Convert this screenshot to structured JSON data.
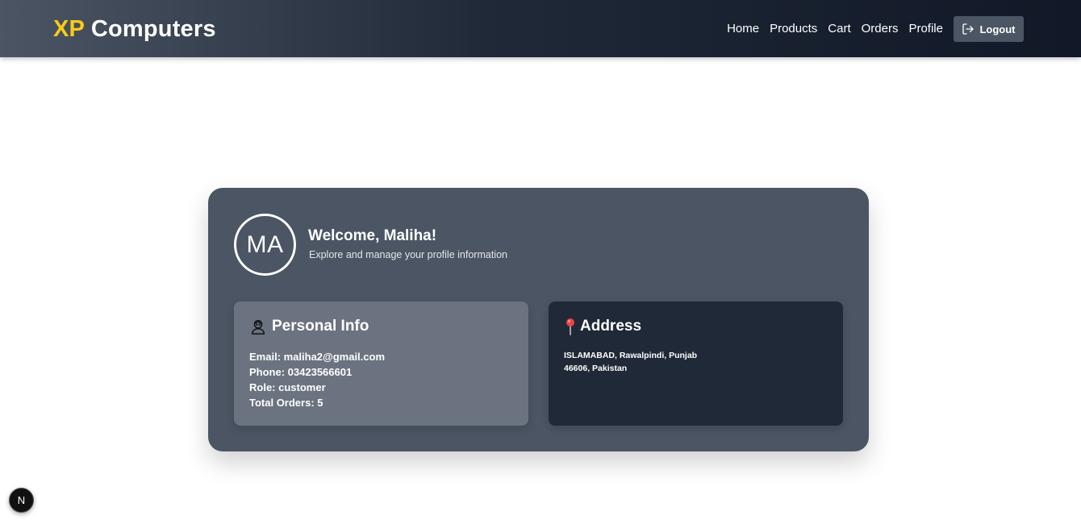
{
  "header": {
    "brand_prefix": "XP",
    "brand_rest": "Computers",
    "nav": [
      "Home",
      "Products",
      "Cart",
      "Orders",
      "Profile"
    ],
    "logout_label": "Logout"
  },
  "profile": {
    "initials": "MA",
    "welcome": "Welcome, Maliha!",
    "subtitle": "Explore and manage your profile information",
    "personal": {
      "title": "Personal Info",
      "email": "Email: maliha2@gmail.com",
      "phone": "Phone: 03423566601",
      "role": "Role: customer",
      "orders": "Total Orders: 5"
    },
    "address": {
      "title": "Address",
      "line1": "ISLAMABAD, Rawalpindi, Punjab",
      "line2": "46606, Pakistan"
    }
  },
  "dev_badge": "N",
  "colors": {
    "brand_accent": "#facc15",
    "card_bg": "#4b5563",
    "personal_bg": "#6b7280",
    "address_bg": "#1f2937",
    "pin_red": "#ef4444"
  },
  "icons": {
    "logout": "logout-icon",
    "personal": "person-icon",
    "address": "pin-icon"
  }
}
